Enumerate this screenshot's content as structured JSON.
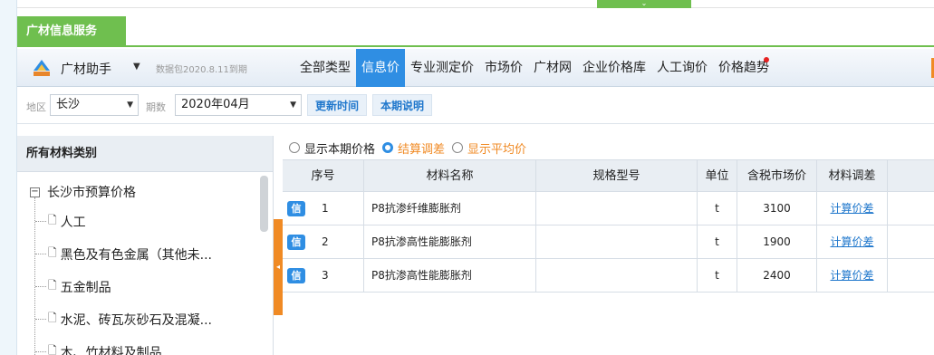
{
  "window": {
    "tab_title": "广材信息服务",
    "toggle_glyph": "⌄"
  },
  "navbar": {
    "logo_icon": "gldsoft-logo-icon",
    "app_name": "广材助手",
    "app_caret": "▼",
    "package_date": "数据包2020.8.11到期",
    "items": [
      {
        "label": "全部类型",
        "active": false
      },
      {
        "label": "信息价",
        "active": true
      },
      {
        "label": "专业测定价",
        "active": false
      },
      {
        "label": "市场价",
        "active": false
      },
      {
        "label": "广材网",
        "active": false
      },
      {
        "label": "企业价格库",
        "active": false
      },
      {
        "label": "人工询价",
        "active": false
      },
      {
        "label": "价格趋势",
        "active": false,
        "notify": true
      }
    ]
  },
  "filters": {
    "region_label": "地区",
    "region_value": "长沙",
    "period_label": "期数",
    "period_value": "2020年04月",
    "update_button": "更新时间",
    "notes_button": "本期说明",
    "caret": "▼"
  },
  "sidebar": {
    "title": "所有材料类别",
    "root": "长沙市预算价格",
    "root_toggle": "−",
    "items": [
      "人工",
      "黑色及有色金属（其他未...",
      "五金制品",
      "水泥、砖瓦灰砂石及混凝...",
      "木、竹材料及制品"
    ]
  },
  "options": {
    "items": [
      {
        "label": "显示本期价格",
        "selected": false,
        "color": "#222222"
      },
      {
        "label": "结算调差",
        "selected": true,
        "color": "#f08a24"
      },
      {
        "label": "显示平均价",
        "selected": false,
        "color": "#f08a24"
      }
    ]
  },
  "table": {
    "headers": {
      "seq": "序号",
      "name": "材料名称",
      "spec": "规格型号",
      "unit": "单位",
      "price": "含税市场价",
      "adjust": "材料调差"
    },
    "badge": "信",
    "rows": [
      {
        "seq": "1",
        "name": "P8抗渗纤维膨胀剂",
        "spec": "",
        "unit": "t",
        "price": "3100",
        "adjust": "计算价差"
      },
      {
        "seq": "2",
        "name": "P8抗渗高性能膨胀剂",
        "spec": "",
        "unit": "t",
        "price": "1900",
        "adjust": "计算价差"
      },
      {
        "seq": "3",
        "name": "P8抗渗高性能膨胀剂",
        "spec": "",
        "unit": "t",
        "price": "2400",
        "adjust": "计算价差"
      }
    ]
  },
  "colors": {
    "brand_green": "#6fbf4f",
    "active_blue": "#2f8ee3",
    "accent_orange": "#f08a24",
    "link_blue": "#1f77cc"
  }
}
